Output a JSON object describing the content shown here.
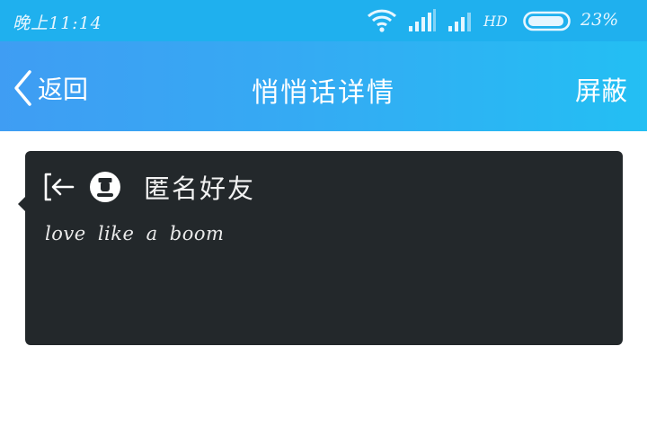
{
  "status_bar": {
    "time": "晚上11:14",
    "network_label": "HD",
    "battery_percent": "23%",
    "battery_level": 0.23,
    "icons": [
      "wifi-icon",
      "signal-icon",
      "signal-icon",
      "battery-icon"
    ]
  },
  "nav": {
    "back_label": "返回",
    "title": "悄悄话详情",
    "block_label": "屏蔽"
  },
  "message": {
    "sender": "匿名好友",
    "text": "love like a boom",
    "icons": [
      "exit-icon",
      "anonymous-avatar-icon"
    ]
  },
  "colors": {
    "status_bar": "#1fb0ee",
    "nav_gradient_start": "#3f9df3",
    "nav_gradient_end": "#23bff3",
    "card_background": "#23282b"
  }
}
